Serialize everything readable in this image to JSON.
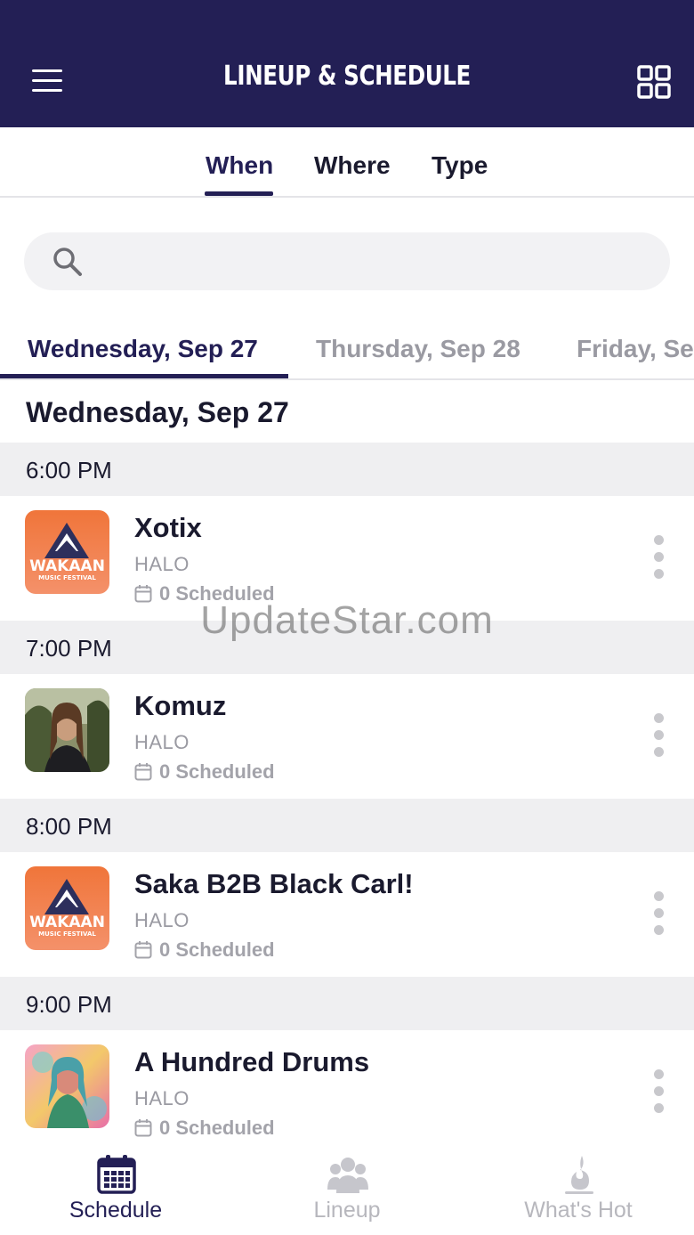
{
  "header": {
    "title": "LINEUP & SCHEDULE",
    "menu_icon": "hamburger-menu-icon",
    "grid_icon": "grid-view-icon"
  },
  "filter_tabs": [
    {
      "label": "When",
      "active": true
    },
    {
      "label": "Where",
      "active": false
    },
    {
      "label": "Type",
      "active": false
    }
  ],
  "search": {
    "placeholder": "",
    "icon": "search-icon"
  },
  "day_tabs": [
    {
      "label": "Wednesday, Sep 27",
      "active": true
    },
    {
      "label": "Thursday, Sep 28",
      "active": false
    },
    {
      "label": "Friday, Se",
      "active": false
    }
  ],
  "day_heading": "Wednesday, Sep 27",
  "logo_text": {
    "main": "WAKAAN",
    "sub": "MUSIC FESTIVAL"
  },
  "slots": [
    {
      "time": "6:00 PM",
      "event": {
        "name": "Xotix",
        "venue": "HALO",
        "scheduled": "0 Scheduled",
        "thumb": "wakaan-logo"
      }
    },
    {
      "time": "7:00 PM",
      "event": {
        "name": "Komuz",
        "venue": "HALO",
        "scheduled": "0 Scheduled",
        "thumb": "artist-photo"
      }
    },
    {
      "time": "8:00 PM",
      "event": {
        "name": "Saka B2B Black Carl!",
        "venue": "HALO",
        "scheduled": "0 Scheduled",
        "thumb": "wakaan-logo"
      }
    },
    {
      "time": "9:00 PM",
      "event": {
        "name": "A Hundred Drums",
        "venue": "HALO",
        "scheduled": "0 Scheduled",
        "thumb": "artist-art"
      }
    }
  ],
  "watermark": "UpdateStar.com",
  "bottom_nav": [
    {
      "label": "Schedule",
      "icon": "calendar-icon",
      "active": true
    },
    {
      "label": "Lineup",
      "icon": "people-icon",
      "active": false
    },
    {
      "label": "What's Hot",
      "icon": "flame-icon",
      "active": false
    }
  ],
  "colors": {
    "primary": "#231f55",
    "inactive": "#9a9aa2",
    "section_bg": "#efeff1"
  }
}
